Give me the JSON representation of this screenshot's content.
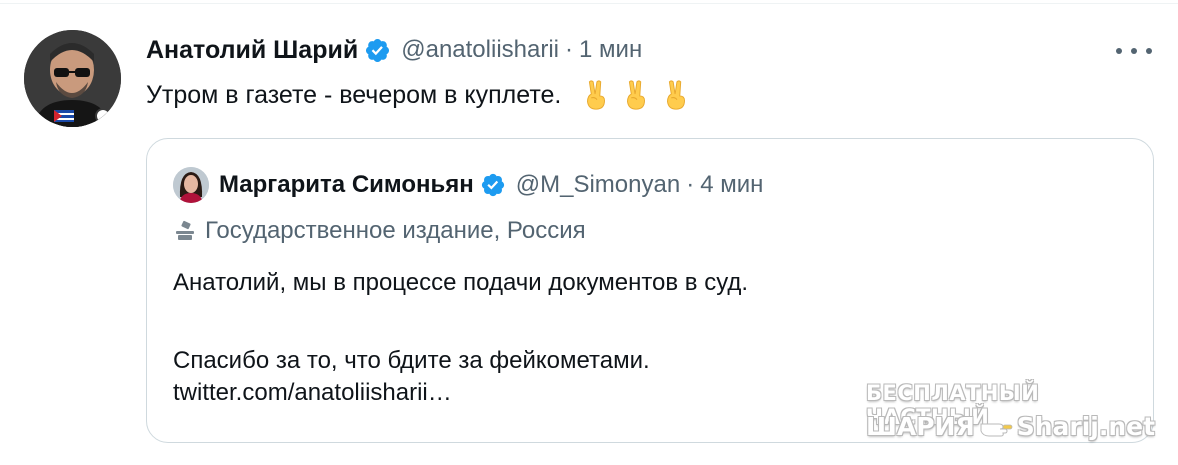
{
  "tweet": {
    "author_name": "Анатолий Шарий",
    "author_handle": "@anatoliisharii",
    "separator": "·",
    "time": "1 мин",
    "text": "Утром в газете - вечером в куплете.",
    "emojis": [
      "victory-hand-icon",
      "victory-hand-icon",
      "victory-hand-icon"
    ],
    "more_icon": "more-icon"
  },
  "quoted_tweet": {
    "author_name": "Маргарита Симоньян",
    "author_handle": "@M_Simonyan",
    "separator": "·",
    "time": "4 мин",
    "label": "Государственное издание, Россия",
    "label_icon": "state-media-icon",
    "body_line1": "Анатолий, мы в процессе подачи документов в суд.",
    "body_line2": "Спасибо за то, что бдите за фейкометами.",
    "body_link": "twitter.com/anatoliisharii…"
  },
  "watermark": {
    "line1": "БЕСПЛАТНЫЙ ЧАСТНЫЙ",
    "line2_left": "ШАРИЯ",
    "line2_right": "Sharij.net"
  },
  "colors": {
    "verified_blue": "#1d9bf0",
    "text_primary": "#0f1419",
    "text_secondary": "#536471",
    "border": "#cfd9de",
    "emoji_yellow": "#ffcc4d"
  }
}
